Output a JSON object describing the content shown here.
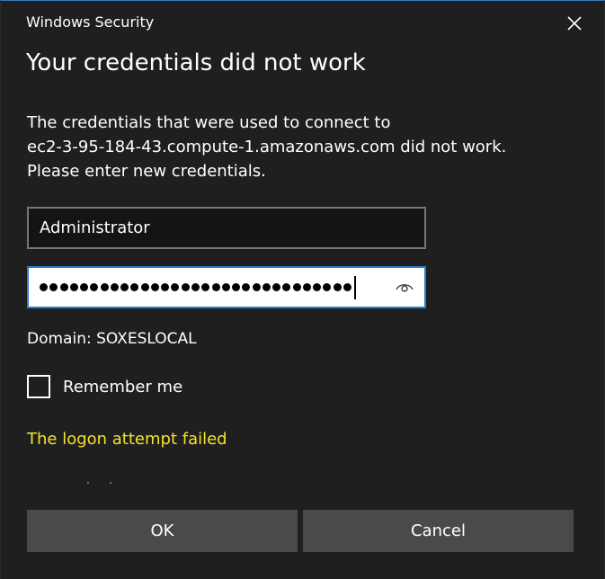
{
  "window": {
    "title": "Windows Security",
    "close_icon": "close-icon"
  },
  "dialog": {
    "heading": "Your credentials did not work",
    "message_lines": [
      "The credentials that were used to connect to",
      "ec2-3-95-184-43.compute-1.amazonaws.com did not work.",
      "Please enter new credentials."
    ]
  },
  "fields": {
    "username": "Administrator",
    "password_mask_count": 31,
    "reveal_icon": "eye-icon"
  },
  "domain": "Domain: SOXESLOCAL",
  "remember": {
    "label": "Remember me",
    "checked": false
  },
  "error_text": "The logon attempt failed",
  "buttons": {
    "ok": "OK",
    "cancel": "Cancel"
  },
  "colors": {
    "background": "#1f1f1f",
    "accent": "#2d7dd2",
    "error": "#f4e12b",
    "button": "#4a4a4a"
  }
}
